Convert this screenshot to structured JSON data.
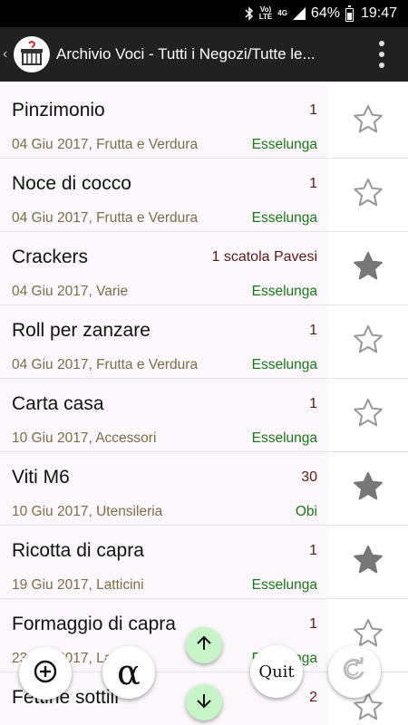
{
  "status_bar": {
    "signal_label_top": "Vo)",
    "signal_label_bottom": "LTE",
    "network_label": "4G",
    "battery_percent": "64%",
    "time": "19:47",
    "icons": [
      "bluetooth-icon",
      "volte-icon",
      "signal-icon",
      "battery-icon"
    ]
  },
  "app_bar": {
    "title": "Archivio Voci - Tutti i Negozi/Tutte le...",
    "icons": [
      "back-caret-icon",
      "shopping-cart-icon",
      "overflow-menu-icon"
    ]
  },
  "items": [
    {
      "name": "Pinzimonio",
      "qty": "1",
      "meta": "04 Giu 2017, Frutta e Verdura",
      "shop": "Esselunga",
      "favorite": false
    },
    {
      "name": "Noce di cocco",
      "qty": "1",
      "meta": "04 Giu 2017, Frutta e Verdura",
      "shop": "Esselunga",
      "favorite": false
    },
    {
      "name": "Crackers",
      "qty": "1 scatola Pavesi",
      "meta": "04 Giu 2017, Varie",
      "shop": "Esselunga",
      "favorite": true
    },
    {
      "name": "Roll per zanzare",
      "qty": "1",
      "meta": "04 Giu 2017, Frutta e Verdura",
      "shop": "Esselunga",
      "favorite": false
    },
    {
      "name": "Carta casa",
      "qty": "1",
      "meta": "10 Giu 2017, Accessori",
      "shop": "Esselunga",
      "favorite": false
    },
    {
      "name": "Viti M6",
      "qty": "30",
      "meta": "10 Giu 2017, Utensileria",
      "shop": "Obi",
      "favorite": true
    },
    {
      "name": "Ricotta di capra",
      "qty": "1",
      "meta": "19 Giu 2017, Latticini",
      "shop": "Esselunga",
      "favorite": true
    },
    {
      "name": "Formaggio di capra",
      "qty": "1",
      "meta": "23 Giu 2017, Latticini",
      "shop": "Esselunga",
      "favorite": false
    },
    {
      "name": "Fettine sottili",
      "qty": "2",
      "meta": "",
      "shop": "",
      "favorite": false
    }
  ],
  "fabs": {
    "alpha_label": "α",
    "quit_label": "Quit",
    "icons": [
      "add-circle-icon",
      "alpha-sort-icon",
      "arrow-up-icon",
      "arrow-down-icon",
      "reload-icon"
    ]
  },
  "colors": {
    "status_bar_bg": "#000000",
    "action_bar_bg": "#212121",
    "row_bg": "#fbf7fa",
    "qty_color": "#5a1a1a",
    "meta_color": "#7a6e4a",
    "shop_color": "#1a7a1a",
    "arrow_button_bg": "#c8f5c8"
  }
}
